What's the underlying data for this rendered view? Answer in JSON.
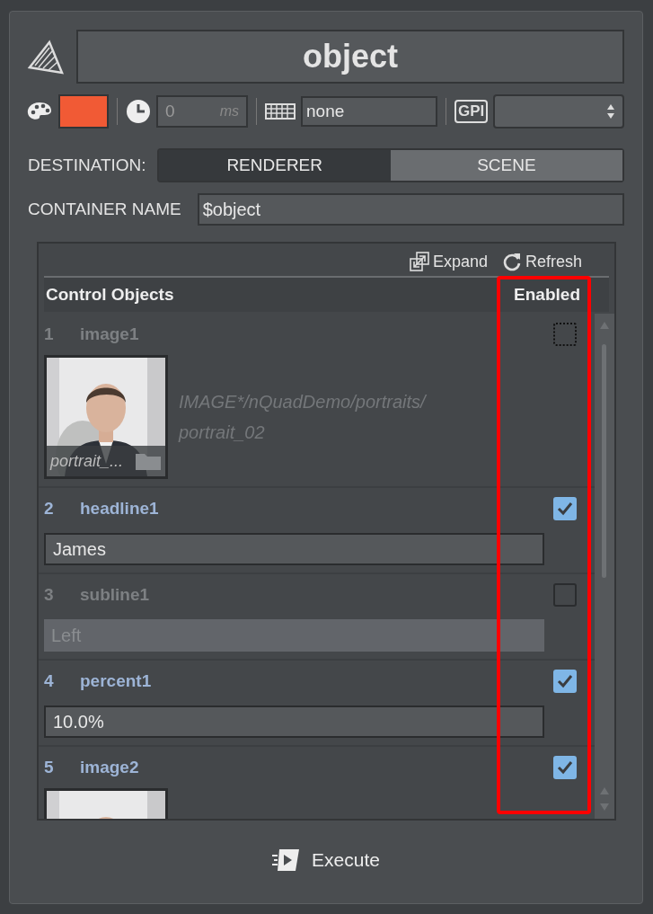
{
  "title": "object",
  "toolbar": {
    "color": "#f15a35",
    "delay": "0",
    "delay_unit": "ms",
    "keyboard": "none",
    "gpi_label": "GPI"
  },
  "destination": {
    "label": "DESTINATION:",
    "options": [
      {
        "label": "RENDERER",
        "selected": true
      },
      {
        "label": "SCENE",
        "selected": false
      }
    ]
  },
  "container_name": {
    "label": "CONTAINER NAME",
    "value": "$object"
  },
  "control_objects": {
    "actions": [
      "Expand",
      "Refresh"
    ],
    "columns": [
      "Control Objects",
      "Enabled"
    ],
    "rows": [
      {
        "index": "1",
        "name": "image1",
        "checked": false,
        "focused": true,
        "caption": "portrait_...",
        "path": "IMAGE*/nQuadDemo/portraits/portrait_02"
      },
      {
        "kind": "text",
        "index": "2",
        "name": "headline1",
        "checked": true,
        "focused": false,
        "value": "James"
      },
      {
        "kind": "text",
        "index": "3",
        "name": "subline1",
        "checked": false,
        "focused": false,
        "value": "Left"
      },
      {
        "kind": "text",
        "index": "4",
        "name": "percent1",
        "checked": true,
        "focused": false,
        "value": "10.0%"
      },
      {
        "index": "5",
        "name": "image2",
        "checked": true,
        "focused": false
      }
    ]
  },
  "annotation": {
    "kind": "highlight-box",
    "color": "#ff0000"
  },
  "execute": "Execute"
}
